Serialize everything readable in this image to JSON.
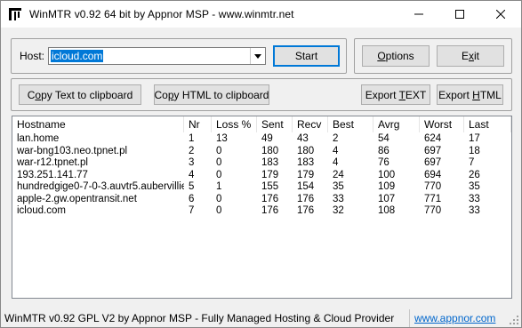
{
  "window": {
    "title": "WinMTR v0.92 64 bit by Appnor MSP - www.winmtr.net"
  },
  "host": {
    "label": "Host:",
    "value": "icloud.com"
  },
  "buttons": {
    "start": "Start",
    "options_pre": "",
    "options_ul": "O",
    "options_post": "ptions",
    "exit_pre": "E",
    "exit_ul": "x",
    "exit_post": "it",
    "copy_text_pre": "C",
    "copy_text_ul": "o",
    "copy_text_post": "py Text to clipboard",
    "copy_html_pre": "Co",
    "copy_html_ul": "p",
    "copy_html_post": "y HTML to clipboard",
    "export_text_pre": "Export ",
    "export_text_ul": "T",
    "export_text_post": "EXT",
    "export_html_pre": "Export ",
    "export_html_ul": "H",
    "export_html_post": "TML"
  },
  "table": {
    "columns": [
      "Hostname",
      "Nr",
      "Loss %",
      "Sent",
      "Recv",
      "Best",
      "Avrg",
      "Worst",
      "Last"
    ],
    "rows": [
      [
        "lan.home",
        "1",
        "13",
        "49",
        "43",
        "2",
        "54",
        "624",
        "17"
      ],
      [
        "war-bng103.neo.tpnet.pl",
        "2",
        "0",
        "180",
        "180",
        "4",
        "86",
        "697",
        "18"
      ],
      [
        "war-r12.tpnet.pl",
        "3",
        "0",
        "183",
        "183",
        "4",
        "76",
        "697",
        "7"
      ],
      [
        "193.251.141.77",
        "4",
        "0",
        "179",
        "179",
        "24",
        "100",
        "694",
        "26"
      ],
      [
        "hundredgige0-7-0-3.auvtr5.aubervillie...",
        "5",
        "1",
        "155",
        "154",
        "35",
        "109",
        "770",
        "35"
      ],
      [
        "apple-2.gw.opentransit.net",
        "6",
        "0",
        "176",
        "176",
        "33",
        "107",
        "771",
        "33"
      ],
      [
        "icloud.com",
        "7",
        "0",
        "176",
        "176",
        "32",
        "108",
        "770",
        "33"
      ]
    ]
  },
  "status": {
    "text": "WinMTR v0.92 GPL V2 by Appnor MSP - Fully Managed Hosting & Cloud Provider",
    "link": "www.appnor.com"
  },
  "colors": {
    "accent": "#0078d7",
    "link": "#0066cc"
  }
}
